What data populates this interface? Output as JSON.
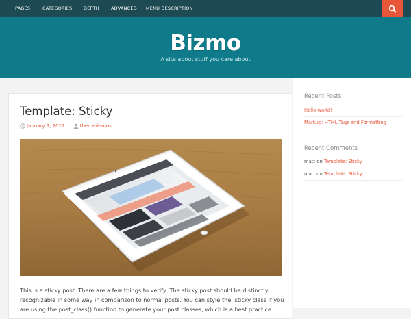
{
  "nav": {
    "items": [
      {
        "label": "PAGES"
      },
      {
        "label": "CATEGORIES"
      },
      {
        "label": "DEPTH"
      },
      {
        "label": "ADVANCED"
      },
      {
        "label": "MENU DESCRIPTION"
      }
    ],
    "search_icon": "search-icon"
  },
  "header": {
    "title": "Bizmo",
    "description": "A site about stuff you care about"
  },
  "post": {
    "title": "Template: Sticky",
    "date": "January 7, 2012",
    "author": "themedemos",
    "excerpt": "This is a sticky post. There are a few things to verify: The sticky post should be distinctly recognizable in some way in comparison to normal posts. You can style the .sticky class if you are using the post_class() function to generate your post classes, which is a best practice."
  },
  "sidebar": {
    "recent_posts_title": "Recent Posts",
    "recent_posts": [
      {
        "label": "Hello world!"
      },
      {
        "label": "Markup: HTML Tags and Formatting"
      }
    ],
    "recent_comments_title": "Recent Comments",
    "recent_comments": [
      {
        "author": "matt",
        "on": "on",
        "post": "Template: Sticky"
      },
      {
        "author": "matt",
        "on": "on",
        "post": "Template: Sticky"
      }
    ]
  },
  "colors": {
    "nav_bg": "#1d4a53",
    "header_bg": "#0e7a8a",
    "accent": "#e8563a"
  }
}
